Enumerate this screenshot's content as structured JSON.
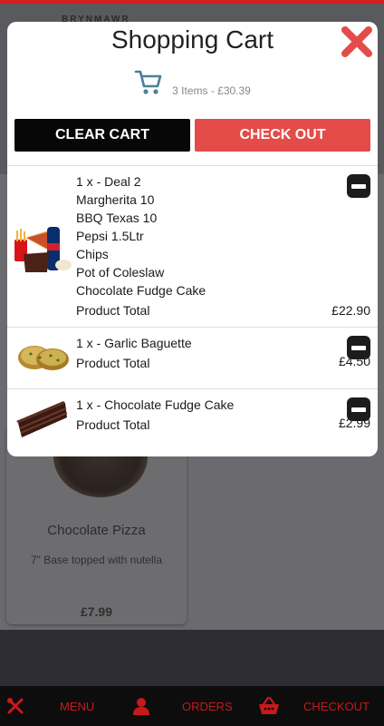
{
  "background": {
    "logo_text": "BRYNMAWR",
    "card": {
      "title": "Chocolate Pizza",
      "description": "7\" Base topped with nutella",
      "price": "£7.99"
    }
  },
  "cart": {
    "title": "Shopping Cart",
    "summary": "3 Items - £30.39",
    "clear_label": "CLEAR CART",
    "checkout_label": "CHECK OUT",
    "items": [
      {
        "line": "1 x - Deal 2",
        "details": [
          "Margherita 10",
          "BBQ Texas 10",
          "Pepsi 1.5Ltr",
          "Chips",
          "Pot of Coleslaw",
          "Chocolate Fudge Cake"
        ],
        "total_label": "Product Total",
        "total": "£22.90"
      },
      {
        "line": "1 x - Garlic Baguette",
        "total_label": "Product Total",
        "total": "£4.50"
      },
      {
        "line": "1 x - Chocolate Fudge Cake",
        "total_label": "Product Total",
        "total": "£2.99"
      }
    ]
  },
  "bottom_nav": {
    "menu_label": "MENU",
    "orders_label": "ORDERS",
    "checkout_label": "CHECKOUT",
    "menu_icon": "cutlery-icon",
    "orders_icon": "user-icon",
    "checkout_icon": "basket-icon"
  },
  "colors": {
    "accent_red": "#e34c48",
    "nav_red": "#c8191b",
    "black": "#070707"
  }
}
